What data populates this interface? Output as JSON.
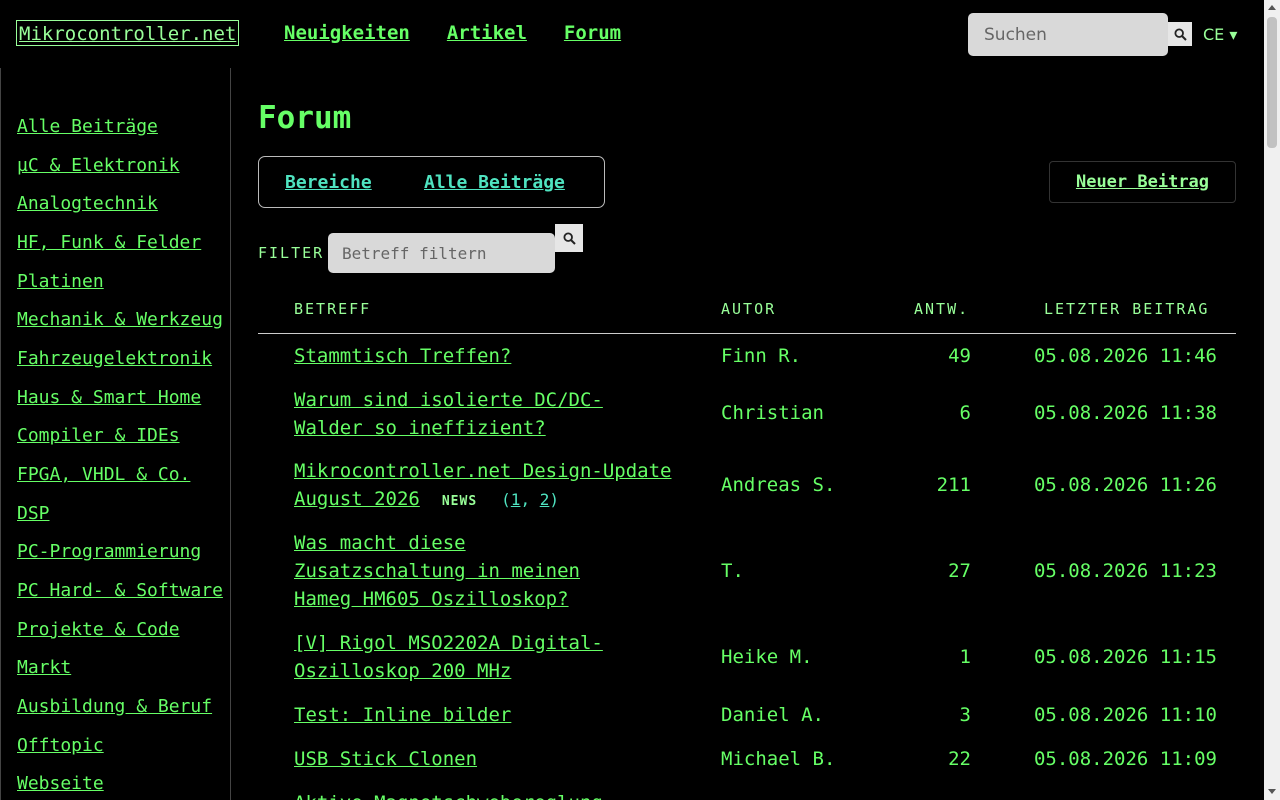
{
  "header": {
    "logo": "Mikrocontroller.net",
    "nav": [
      "Neuigkeiten",
      "Artikel",
      "Forum"
    ],
    "search_placeholder": "Suchen",
    "lang": "CE ▾"
  },
  "sidebar": {
    "items": [
      "Alle Beiträge",
      "µC & Elektronik",
      "Analogtechnik",
      "HF, Funk & Felder",
      "Platinen",
      "Mechanik & Werkzeug",
      "Fahrzeugelektronik",
      "Haus & Smart Home",
      "Compiler & IDEs",
      "FPGA, VHDL & Co.",
      "DSP",
      "PC-Programmierung",
      "PC Hard- & Software",
      "Projekte & Code",
      "Markt",
      "Ausbildung & Beruf",
      "Offtopic",
      "Webseite"
    ]
  },
  "main": {
    "title": "Forum",
    "tabs": [
      "Bereiche",
      "Alle Beiträge"
    ],
    "new_post": "Neuer Beitrag",
    "filter_label": "FILTER",
    "filter_placeholder": "Betreff filtern",
    "columns": {
      "subject": "BETREFF",
      "author": "AUTOR",
      "replies": "ANTW.",
      "last": "LETZTER BEITRAG"
    },
    "rows": [
      {
        "subject": "Stammtisch Treffen?",
        "author": "Finn R.",
        "replies": "49",
        "last": "05.08.2026 11:46"
      },
      {
        "subject": "Warum sind isolierte DC/DC-Walder so ineffizient?",
        "author": "Christian",
        "replies": "6",
        "last": "05.08.2026 11:38"
      },
      {
        "subject": "Mikrocontroller.net Design-Update August 2026",
        "badge": "NEWS",
        "pages_open": "(",
        "page1": "1",
        "page_sep": ", ",
        "page2": "2",
        "pages_close": ")",
        "author": "Andreas S.",
        "replies": "211",
        "last": "05.08.2026 11:26"
      },
      {
        "subject": "Was macht diese Zusatzschaltung in meinen Hameg HM605 Oszilloskop?",
        "author": "T.",
        "replies": "27",
        "last": "05.08.2026 11:23"
      },
      {
        "subject": "[V] Rigol MSO2202A Digital-Oszilloskop 200 MHz",
        "author": "Heike M.",
        "replies": "1",
        "last": "05.08.2026 11:15"
      },
      {
        "subject": "Test: Inline bilder",
        "author": "Daniel A.",
        "replies": "3",
        "last": "05.08.2026 11:10"
      },
      {
        "subject": "USB Stick Clonen",
        "author": "Michael B.",
        "replies": "22",
        "last": "05.08.2026 11:09"
      },
      {
        "subject": "Aktive Magnetschwebereglung",
        "author": "",
        "replies": "",
        "last": ""
      }
    ]
  },
  "colors": {
    "background": "#000000",
    "text": "#66ff66",
    "accent_tab": "#4fe3c0"
  }
}
